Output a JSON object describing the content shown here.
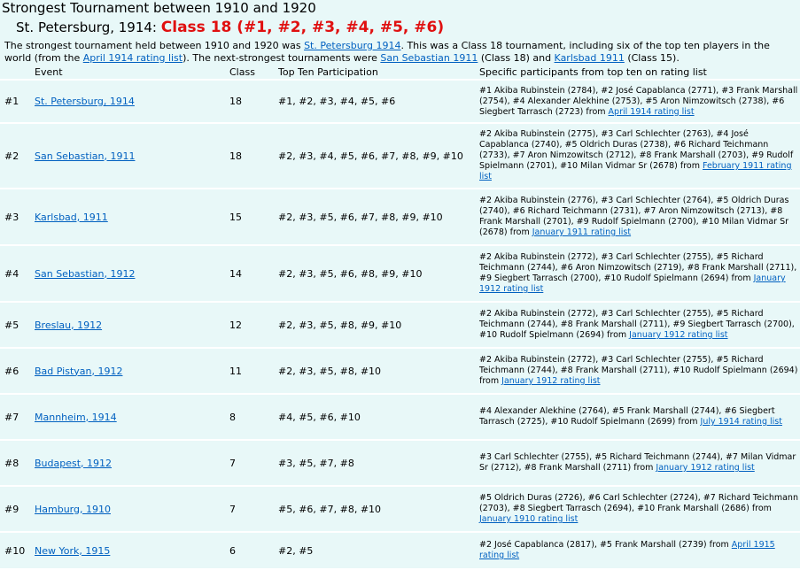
{
  "title": "Strongest Tournament between 1910 and 1920",
  "subtitle": {
    "event": "St. Petersburg, 1914:",
    "class": "Class 18 (#1, #2, #3, #4, #5, #6)"
  },
  "intro": {
    "part1": "The strongest tournament held between 1910 and 1920 was ",
    "link1": "St. Petersburg 1914",
    "part2": ". This was a Class 18 tournament, including six of the top ten players in the world (from the ",
    "link2": "April 1914 rating list",
    "part3": "). The next-strongest tournaments were ",
    "link3": "San Sebastian 1911",
    "part4": " (Class 18) and ",
    "link4": "Karlsbad 1911",
    "part5": " (Class 15)."
  },
  "table": {
    "headers": [
      "",
      "Event",
      "Class",
      "Top Ten Participation",
      "Specific participants from top ten on rating list"
    ],
    "rows": [
      {
        "rank": "#1",
        "event": "St. Petersburg, 1914",
        "class": "18",
        "top": "#1, #2, #3, #4, #5, #6",
        "participants": "#1 Akiba Rubinstein (2784), #2 José Capablanca (2771), #3 Frank Marshall (2754), #4 Alexander Alekhine (2753), #5 Aron Nimzowitsch (2738), #6 Siegbert Tarrasch (2723) from ",
        "list": "April 1914 rating list"
      },
      {
        "rank": "#2",
        "event": "San Sebastian, 1911",
        "class": "18",
        "top": "#2, #3, #4, #5, #6, #7, #8, #9, #10",
        "participants": "#2 Akiba Rubinstein (2775), #3 Carl Schlechter (2763), #4 José Capablanca (2740), #5 Oldrich Duras (2738), #6 Richard Teichmann (2733), #7 Aron Nimzowitsch (2712), #8 Frank Marshall (2703), #9 Rudolf Spielmann (2701), #10 Milan Vidmar Sr (2678) from ",
        "list": "February 1911 rating list"
      },
      {
        "rank": "#3",
        "event": "Karlsbad, 1911",
        "class": "15",
        "top": "#2, #3, #5, #6, #7, #8, #9, #10",
        "participants": "#2 Akiba Rubinstein (2776), #3 Carl Schlechter (2764), #5 Oldrich Duras (2740), #6 Richard Teichmann (2731), #7 Aron Nimzowitsch (2713), #8 Frank Marshall (2701), #9 Rudolf Spielmann (2700), #10 Milan Vidmar Sr (2678) from ",
        "list": "January 1911 rating list"
      },
      {
        "rank": "#4",
        "event": "San Sebastian, 1912",
        "class": "14",
        "top": "#2, #3, #5, #6, #8, #9, #10",
        "participants": "#2 Akiba Rubinstein (2772), #3 Carl Schlechter (2755), #5 Richard Teichmann (2744), #6 Aron Nimzowitsch (2719), #8 Frank Marshall (2711), #9 Siegbert Tarrasch (2700), #10 Rudolf Spielmann (2694) from ",
        "list": "January 1912 rating list"
      },
      {
        "rank": "#5",
        "event": "Breslau, 1912",
        "class": "12",
        "top": "#2, #3, #5, #8, #9, #10",
        "participants": "#2 Akiba Rubinstein (2772), #3 Carl Schlechter (2755), #5 Richard Teichmann (2744), #8 Frank Marshall (2711), #9 Siegbert Tarrasch (2700), #10 Rudolf Spielmann (2694) from ",
        "list": "January 1912 rating list"
      },
      {
        "rank": "#6",
        "event": "Bad Pistyan, 1912",
        "class": "11",
        "top": "#2, #3, #5, #8, #10",
        "participants": "#2 Akiba Rubinstein (2772), #3 Carl Schlechter (2755), #5 Richard Teichmann (2744), #8 Frank Marshall (2711), #10 Rudolf Spielmann (2694) from ",
        "list": "January 1912 rating list"
      },
      {
        "rank": "#7",
        "event": "Mannheim, 1914",
        "class": "8",
        "top": "#4, #5, #6, #10",
        "participants": "#4 Alexander Alekhine (2764), #5 Frank Marshall (2744), #6 Siegbert Tarrasch (2725), #10 Rudolf Spielmann (2699) from ",
        "list": "July 1914 rating list"
      },
      {
        "rank": "#8",
        "event": "Budapest, 1912",
        "class": "7",
        "top": "#3, #5, #7, #8",
        "participants": "#3 Carl Schlechter (2755), #5 Richard Teichmann (2744), #7 Milan Vidmar Sr (2712), #8 Frank Marshall (2711) from ",
        "list": "January 1912 rating list"
      },
      {
        "rank": "#9",
        "event": "Hamburg, 1910",
        "class": "7",
        "top": "#5, #6, #7, #8, #10",
        "participants": "#5 Oldrich Duras (2726), #6 Carl Schlechter (2724), #7 Richard Teichmann (2703), #8 Siegbert Tarrasch (2694), #10 Frank Marshall (2686) from ",
        "list": "January 1910 rating list"
      },
      {
        "rank": "#10",
        "event": "New York, 1915",
        "class": "6",
        "top": "#2, #5",
        "participants": "#2 José Capablanca (2817), #5 Frank Marshall (2739) from ",
        "list": "April 1915 rating list"
      }
    ]
  },
  "colors": {
    "background": "#e8f8f8",
    "link": "#0060c0",
    "class_highlight": "#e01010",
    "row_divider": "#ffffff"
  }
}
